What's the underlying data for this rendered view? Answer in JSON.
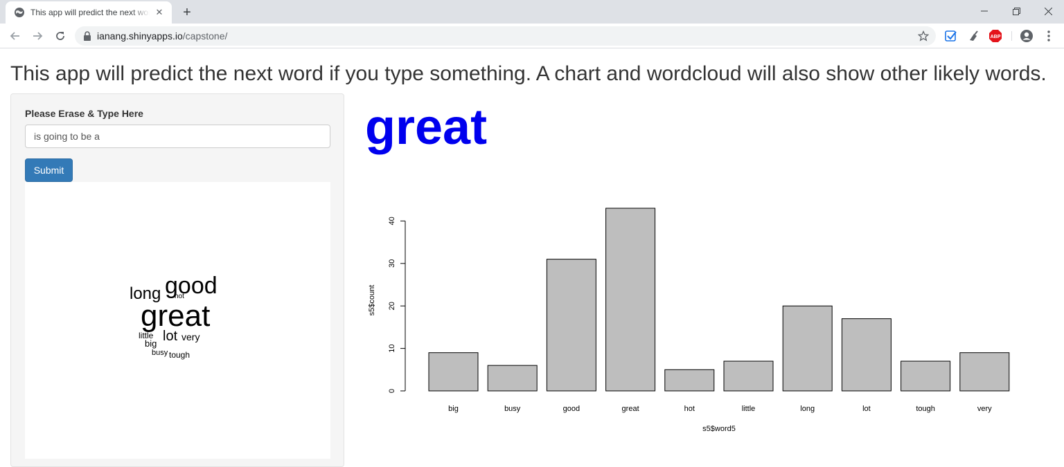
{
  "browser": {
    "tab_title": "This app will predict the next word if you type something",
    "url_host": "ianang.shinyapps.io",
    "url_path": "/capstone/"
  },
  "page": {
    "title": "This app will predict the next word if you type something. A chart and wordcloud will also show other likely words.",
    "input_label": "Please Erase & Type Here",
    "input_value": "is going to be a",
    "submit_label": "Submit",
    "prediction": "great",
    "prediction_color": "#0000ee",
    "button_color": "#337ab7"
  },
  "wordcloud": {
    "words": [
      {
        "word": "great",
        "size": 44
      },
      {
        "word": "good",
        "size": 34
      },
      {
        "word": "long",
        "size": 24
      },
      {
        "word": "lot",
        "size": 20
      },
      {
        "word": "very",
        "size": 14
      },
      {
        "word": "little",
        "size": 12
      },
      {
        "word": "big",
        "size": 13
      },
      {
        "word": "tough",
        "size": 12
      },
      {
        "word": "busy",
        "size": 11
      },
      {
        "word": "hot",
        "size": 10
      }
    ]
  },
  "chart_data": {
    "type": "bar",
    "categories": [
      "big",
      "busy",
      "good",
      "great",
      "hot",
      "little",
      "long",
      "lot",
      "tough",
      "very"
    ],
    "values": [
      9,
      6,
      31,
      43,
      5,
      7,
      20,
      17,
      7,
      9
    ],
    "title": "",
    "xlabel": "s5$word5",
    "ylabel": "s5$count",
    "ylim": [
      0,
      45
    ],
    "yticks": [
      0,
      10,
      20,
      30,
      40
    ],
    "bar_color": "#bebebe",
    "grid": false
  }
}
